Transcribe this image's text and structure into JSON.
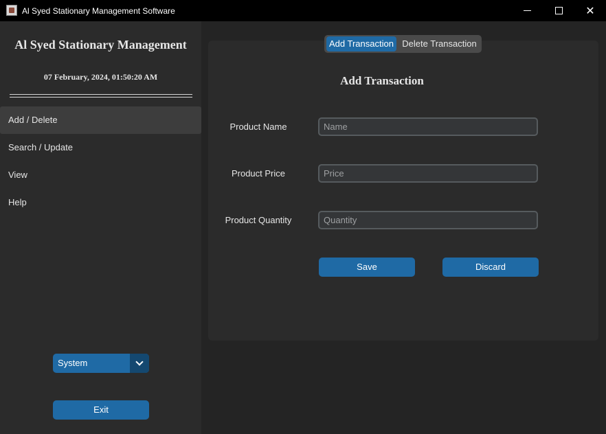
{
  "window": {
    "title": "Al Syed Stationary Management Software",
    "icon": "app-logo-icon",
    "controls": [
      "minimize-icon",
      "maximize-icon",
      "close-icon"
    ]
  },
  "sidebar": {
    "title": "Al Syed Stationary Management",
    "datetime": "07 February, 2024, 01:50:20 AM",
    "separator": "================================",
    "items": [
      {
        "label": "Add / Delete",
        "active": true
      },
      {
        "label": "Search / Update",
        "active": false
      },
      {
        "label": "View",
        "active": false
      },
      {
        "label": "Help",
        "active": false
      }
    ],
    "theme": {
      "value": "System",
      "icon": "chevron-down-icon"
    },
    "exit_label": "Exit"
  },
  "tabs": [
    {
      "label": "Add Transaction",
      "selected": true
    },
    {
      "label": "Delete Transaction",
      "selected": false
    }
  ],
  "form": {
    "title": "Add Transaction",
    "fields": [
      {
        "label": "Product Name",
        "placeholder": "Name",
        "value": ""
      },
      {
        "label": "Product Price",
        "placeholder": "Price",
        "value": ""
      },
      {
        "label": "Product Quantity",
        "placeholder": "Quantity",
        "value": ""
      }
    ],
    "save_label": "Save",
    "discard_label": "Discard"
  },
  "colors": {
    "accent": "#1f6aa5",
    "accent_dark": "#144870",
    "background": "#242424",
    "panel": "#2b2b2b",
    "titlebar": "#000000"
  }
}
